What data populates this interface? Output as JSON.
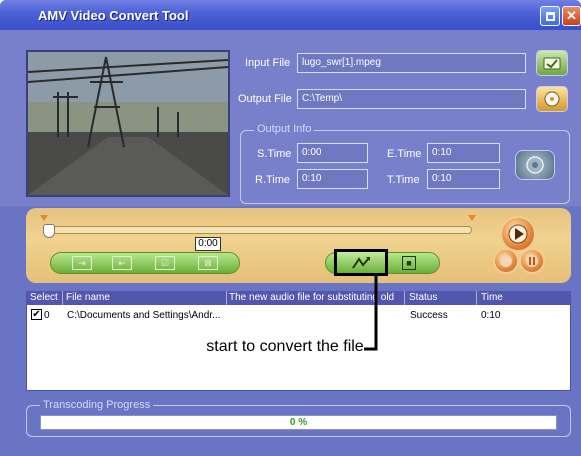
{
  "window": {
    "title": "AMV Video Convert Tool"
  },
  "input": {
    "label": "Input File",
    "value": "lugo_swr[1].mpeg"
  },
  "output": {
    "label": "Output File",
    "value": "C:\\Temp\\"
  },
  "output_info": {
    "title": "Output Info",
    "stime_label": "S.Time",
    "stime_value": "0:00",
    "etime_label": "E.Time",
    "etime_value": "0:10",
    "rtime_label": "R.Time",
    "rtime_value": "0:10",
    "ttime_label": "T.Time",
    "ttime_value": "0:10"
  },
  "player": {
    "current_time": "0:00",
    "position_fraction": 0.0
  },
  "list": {
    "headers": [
      "Select",
      "File name",
      "The new audio file for substituting old",
      "Status",
      "Time"
    ],
    "rows": [
      {
        "checked_mark": "✔",
        "index": "0",
        "file_name": "C:\\Documents and Settings\\Andr...",
        "audio": "",
        "status": "Success",
        "time": "0:10"
      }
    ]
  },
  "annotation": {
    "text": "start to convert the file"
  },
  "progress": {
    "title": "Transcoding Progress",
    "text": "0 %",
    "fraction": 0.0
  },
  "colors": {
    "window_bg": "#6a74c4",
    "titlebar": "#4a5fd8",
    "player_panel": "#f0d28e",
    "control_green": "#6ab03a",
    "progress_text": "#2aa12a"
  },
  "icons": {
    "open_input": "open-folder-icon",
    "browse_output": "disc-icon",
    "convert_settings": "settings-icon",
    "convert": "convert-icon",
    "play": "play-icon"
  }
}
